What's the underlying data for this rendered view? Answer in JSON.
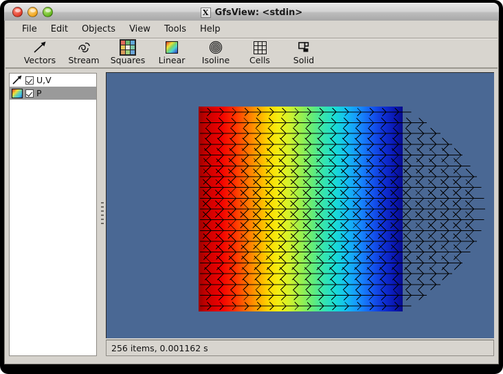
{
  "window": {
    "title": "GfsView: <stdin>",
    "title_icon": "x-app-icon",
    "icon_letter": "X",
    "buttons": [
      {
        "name": "close",
        "label": "Close",
        "color": "#e03d2a"
      },
      {
        "name": "minimize",
        "label": "Minimize",
        "color": "#f0a61f"
      },
      {
        "name": "zoom",
        "label": "Zoom",
        "color": "#65b81f"
      }
    ]
  },
  "menubar": {
    "items": [
      {
        "label": "File"
      },
      {
        "label": "Edit"
      },
      {
        "label": "Objects"
      },
      {
        "label": "View"
      },
      {
        "label": "Tools"
      },
      {
        "label": "Help"
      }
    ]
  },
  "toolbar": {
    "items": [
      {
        "label": "Vectors",
        "icon": "arrow-up-right-icon"
      },
      {
        "label": "Stream",
        "icon": "streamline-icon"
      },
      {
        "label": "Squares",
        "icon": "color-grid-icon"
      },
      {
        "label": "Linear",
        "icon": "linear-colormap-icon"
      },
      {
        "label": "Isoline",
        "icon": "concentric-rings-icon"
      },
      {
        "label": "Cells",
        "icon": "grid-cells-icon"
      },
      {
        "label": "Solid",
        "icon": "solid-shapes-icon"
      }
    ]
  },
  "sidebar": {
    "objects": [
      {
        "label": "U,V",
        "icon": "vector-arrow-icon",
        "checked": true,
        "selected": false
      },
      {
        "label": "P",
        "icon": "colormap-swatch-icon",
        "checked": true,
        "selected": true
      }
    ]
  },
  "glview": {
    "background_color": "#4a6894",
    "field_colormap": "jet",
    "field_description": "horizontal jet-colormap pressure field with velocity vector arrows",
    "vector_color": "#000000"
  },
  "statusbar": {
    "text": "256 items, 0.001162 s"
  }
}
